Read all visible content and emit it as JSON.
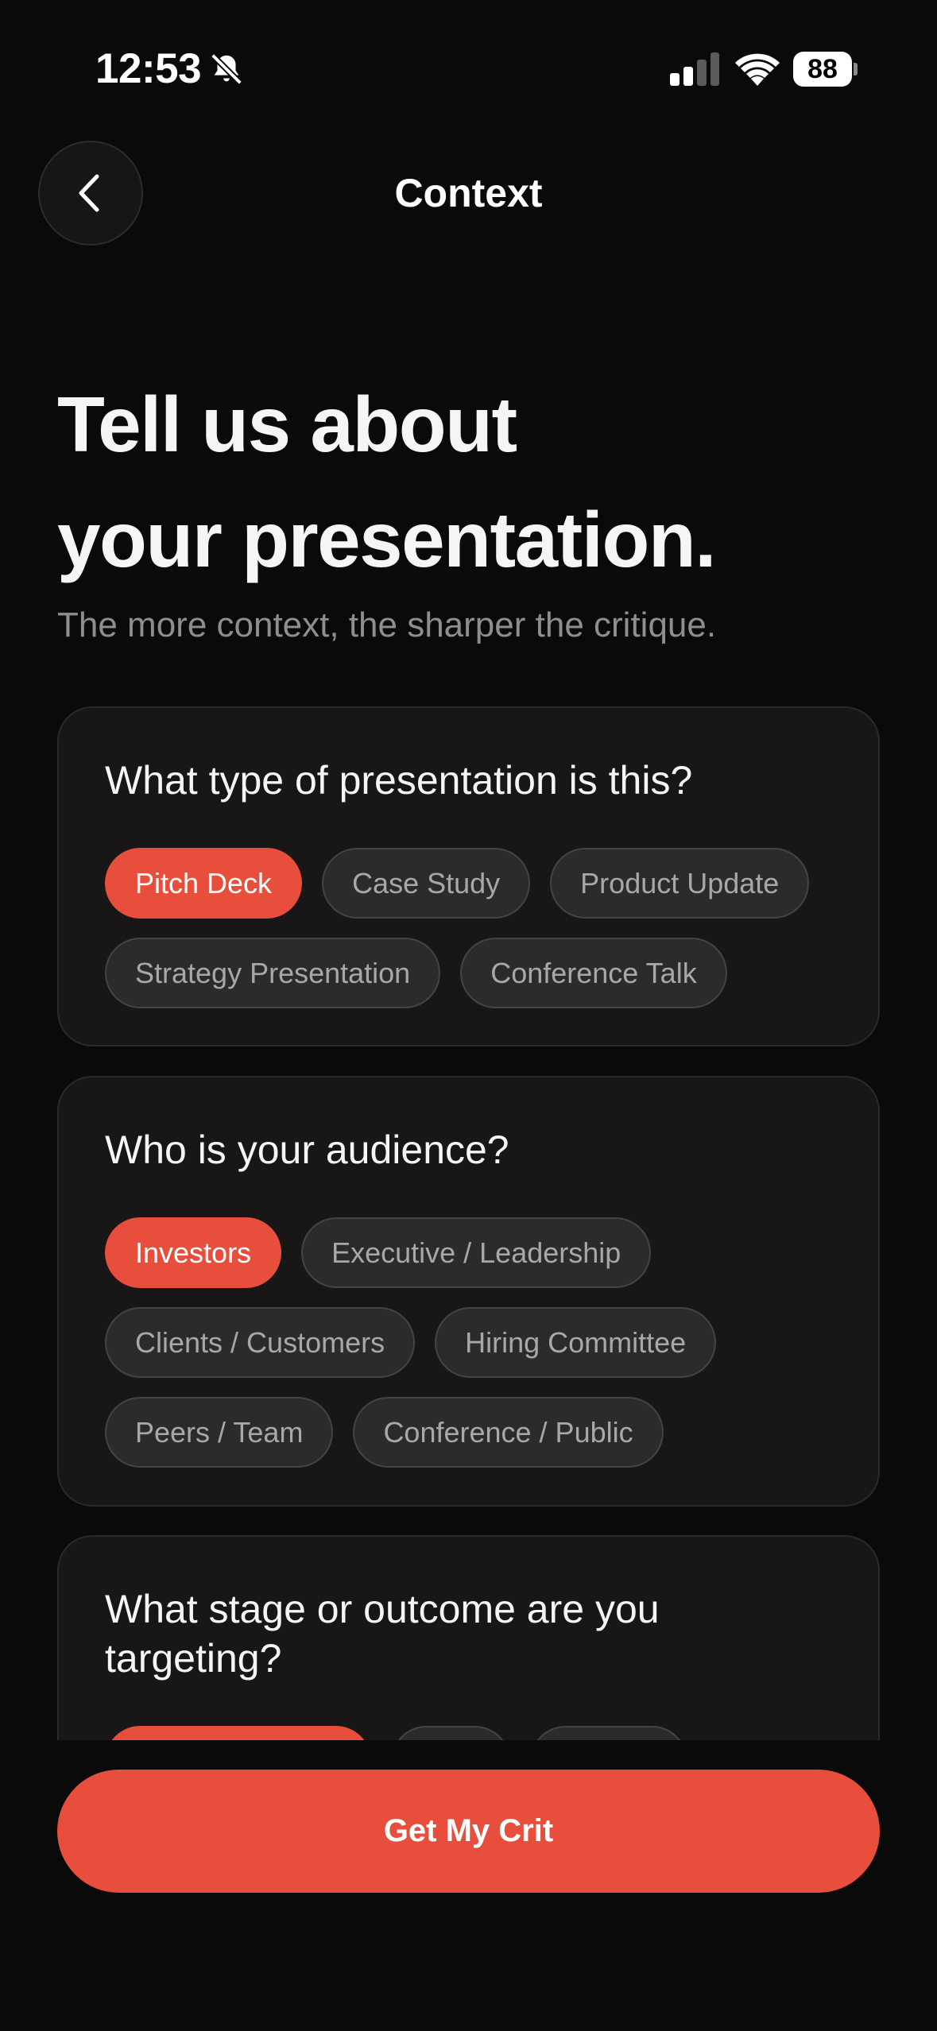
{
  "status_bar": {
    "time": "12:53",
    "battery": "88",
    "icons": [
      "bell-slash-icon",
      "signal-icon",
      "wifi-icon",
      "battery-icon"
    ]
  },
  "header": {
    "title": "Context",
    "back_icon": "chevron-left-icon"
  },
  "hero": {
    "headline_line1": "Tell us about",
    "headline_line2": "your presentation.",
    "subtitle": "The more context, the sharper the critique."
  },
  "questions": [
    {
      "question": "What type of presentation is this?",
      "options": [
        {
          "label": "Pitch Deck",
          "selected": true
        },
        {
          "label": "Case Study",
          "selected": false
        },
        {
          "label": "Product Update",
          "selected": false
        },
        {
          "label": "Strategy Presentation",
          "selected": false
        },
        {
          "label": "Conference Talk",
          "selected": false
        }
      ]
    },
    {
      "question": "Who is your audience?",
      "options": [
        {
          "label": "Investors",
          "selected": true
        },
        {
          "label": "Executive / Leadership",
          "selected": false
        },
        {
          "label": "Clients / Customers",
          "selected": false
        },
        {
          "label": "Hiring Committee",
          "selected": false
        },
        {
          "label": "Peers / Team",
          "selected": false
        },
        {
          "label": "Conference / Public",
          "selected": false
        }
      ]
    },
    {
      "question": "What stage or outcome are you targeting?",
      "options": []
    }
  ],
  "cta": {
    "label": "Get My Crit"
  },
  "colors": {
    "accent": "#e84e3c",
    "background": "#0a0a0a",
    "card": "#181616",
    "chip": "#2b2b2b"
  }
}
